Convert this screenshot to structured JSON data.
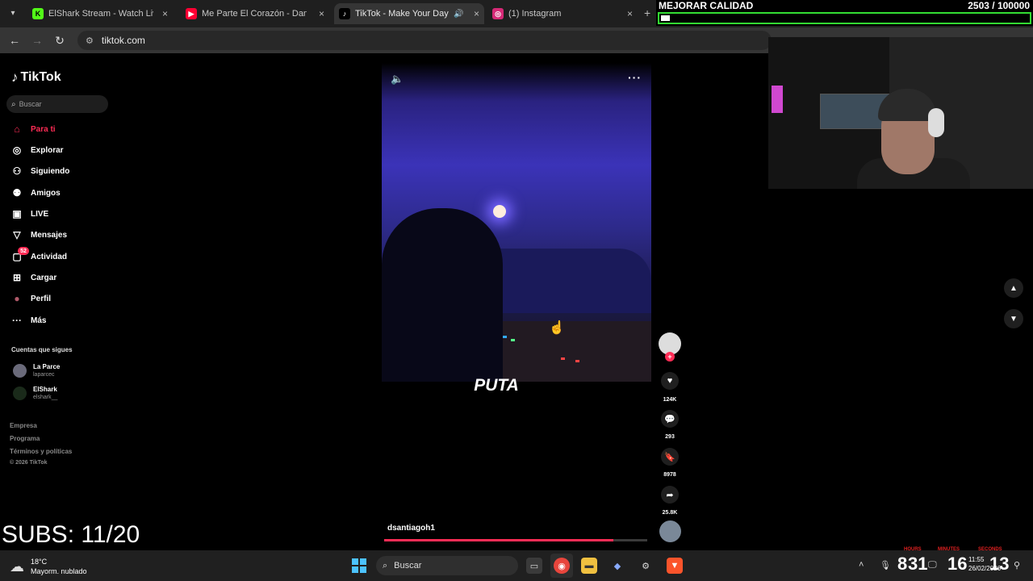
{
  "browser": {
    "tabs": [
      {
        "title": "ElShark Stream - Watch Live on",
        "favicon_color": "#53fc18",
        "favicon_glyph": "K"
      },
      {
        "title": "Me Parte El Corazón - Daniel Ca",
        "favicon_color": "#ff0033",
        "favicon_glyph": "▶"
      },
      {
        "title": "TikTok - Make Your Day",
        "favicon_color": "#000000",
        "favicon_glyph": "♪",
        "active": true
      },
      {
        "title": "(1) Instagram",
        "favicon_color": "#d62976",
        "favicon_glyph": "◎"
      }
    ],
    "close_glyph": "×",
    "newtab_glyph": "+",
    "url": "tiktok.com"
  },
  "overlay": {
    "quality_label": "MEJORAR CALIDAD",
    "quality_count": "2503 / 100000",
    "quality_progress": 0.025,
    "quality_color": "#33dd33",
    "subs": "SUBS: 11/20"
  },
  "tiktok": {
    "brand": "TikTok",
    "accent": "#fe2c55",
    "search_placeholder": "Buscar",
    "nav": [
      {
        "label": "Para ti",
        "icon": "home-icon",
        "glyph": "⌂",
        "active": true
      },
      {
        "label": "Explorar",
        "icon": "compass-icon",
        "glyph": "◎"
      },
      {
        "label": "Siguiendo",
        "icon": "following-icon",
        "glyph": "⚇"
      },
      {
        "label": "Amigos",
        "icon": "friends-icon",
        "glyph": "⚉"
      },
      {
        "label": "LIVE",
        "icon": "live-icon",
        "glyph": "▣"
      },
      {
        "label": "Mensajes",
        "icon": "messages-icon",
        "glyph": "▽"
      },
      {
        "label": "Actividad",
        "icon": "activity-icon",
        "glyph": "▢",
        "badge": "52"
      },
      {
        "label": "Cargar",
        "icon": "upload-icon",
        "glyph": "⊞"
      },
      {
        "label": "Perfil",
        "icon": "profile-avatar-icon",
        "glyph": "●"
      },
      {
        "label": "Más",
        "icon": "more-icon",
        "glyph": "···"
      }
    ],
    "following_title": "Cuentas que sigues",
    "following": [
      {
        "name": "La Parce",
        "handle": "laparcec"
      },
      {
        "name": "ElShark",
        "handle": "elshark__"
      }
    ],
    "footer": [
      "Empresa",
      "Programa",
      "Términos y políticas"
    ],
    "copyright": "© 2026 TikTok",
    "video": {
      "caption": "PUTA",
      "author": "dsantiagoh1",
      "progress": 0.87,
      "likes": "124K",
      "comments": "293",
      "saves": "8978",
      "shares": "25.8K"
    }
  },
  "taskbar": {
    "temperature": "18°C",
    "weather": "Mayorm. nublado",
    "search": "Buscar",
    "clock_hours": "8",
    "clock_minutes": "31",
    "clock_big": "16",
    "clock_seconds": "13",
    "time": "11:55",
    "date": "26/02/2026",
    "label_hours": "HOURS",
    "label_minutes": "MINUTES",
    "label_seconds": "SECONDS"
  }
}
